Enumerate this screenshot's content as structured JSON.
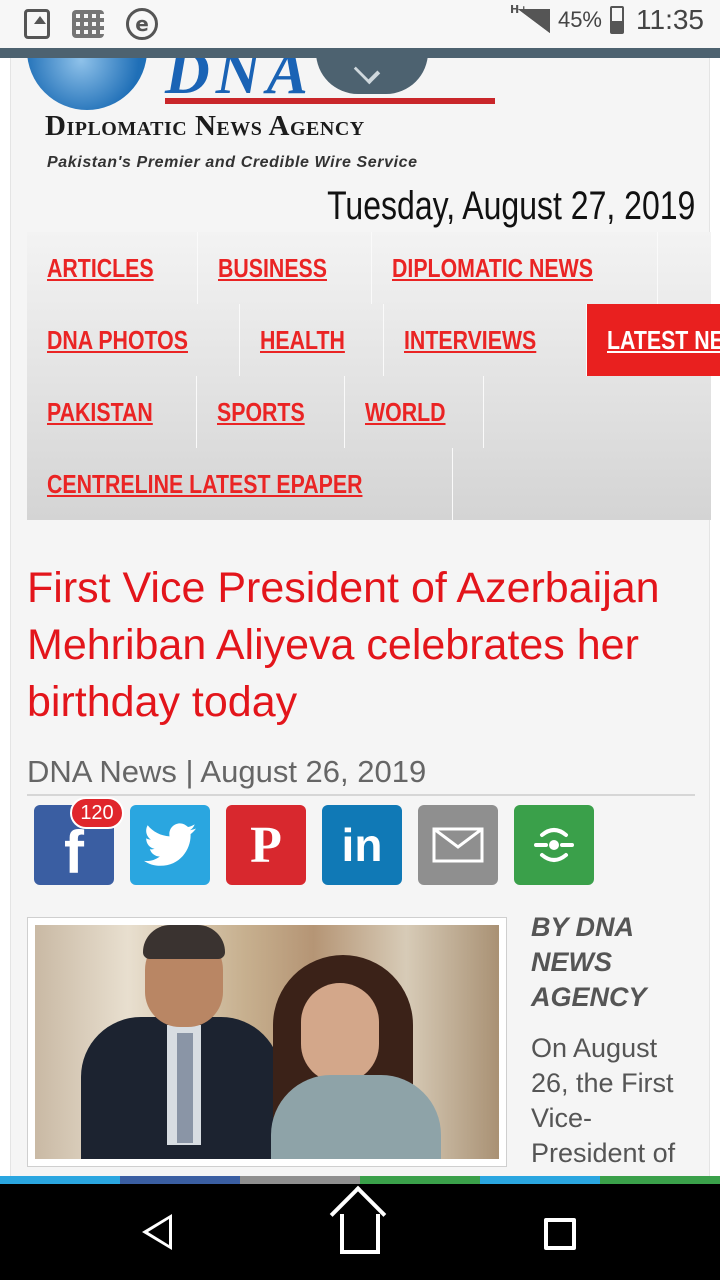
{
  "status_bar": {
    "network": "H+",
    "battery": "45%",
    "time": "11:35",
    "icons": [
      "screenshot-icon",
      "grid-icon",
      "e-icon"
    ]
  },
  "header": {
    "logo_big": "DNA",
    "logo_title": "Diplomatic News Agency",
    "logo_tagline": "Pakistan's Premier and Credible Wire Service",
    "date": "Tuesday, August 27, 2019"
  },
  "menu": {
    "rows": [
      [
        {
          "label": "ARTICLES"
        },
        {
          "label": "BUSINESS"
        },
        {
          "label": "DIPLOMATIC NEWS"
        }
      ],
      [
        {
          "label": "DNA PHOTOS"
        },
        {
          "label": "HEALTH"
        },
        {
          "label": "INTERVIEWS"
        },
        {
          "label": "LATEST NEWS",
          "active": true
        }
      ],
      [
        {
          "label": "PAKISTAN"
        },
        {
          "label": "SPORTS"
        },
        {
          "label": "WORLD"
        }
      ],
      [
        {
          "label": "CENTRELINE LATEST EPAPER"
        }
      ]
    ],
    "active_color": "#e9201f",
    "link_color": "#ea2424"
  },
  "article": {
    "title": "First Vice President of Azerbaijan  Mehriban  Aliyeva celebrates her birthday today",
    "byline": "DNA News | August 26, 2019",
    "author": "BY DNA NEWS AGENCY",
    "intro": "On August 26, the First Vice-President of"
  },
  "share": {
    "facebook_count": "120",
    "buttons": [
      "facebook",
      "twitter",
      "pinterest",
      "linkedin",
      "email",
      "more"
    ],
    "labels": {
      "facebook": "f",
      "pinterest": "P",
      "linkedin": "in"
    }
  },
  "colors": {
    "headline": "#e3151b",
    "facebook": "#3a5ea2",
    "twitter": "#2aa6e0",
    "pinterest": "#d8282e",
    "linkedin": "#1079b6",
    "email": "#8f8f8f",
    "more": "#3aa04a"
  }
}
